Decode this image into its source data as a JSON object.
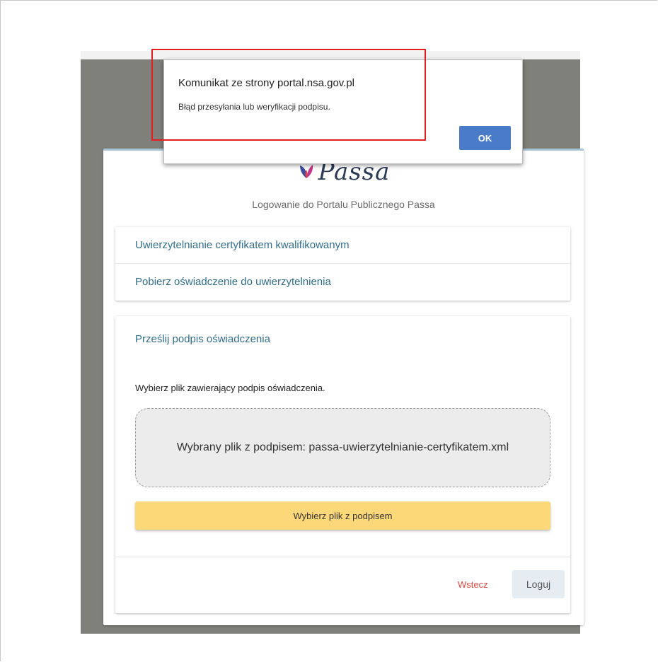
{
  "dialog": {
    "title": "Komunikat ze strony portal.nsa.gov.pl",
    "message": "Błąd przesyłania lub weryfikacji podpisu.",
    "ok_label": "OK"
  },
  "logo": {
    "text": "Passa"
  },
  "subtitle": "Logowanie do Portalu Publicznego Passa",
  "accordion": {
    "items": [
      {
        "label": "Uwierzytelnianie certyfikatem kwalifikowanym"
      },
      {
        "label": "Pobierz oświadczenie do uwierzytelnienia"
      }
    ]
  },
  "upload": {
    "title": "Prześlij podpis oświadczenia",
    "instruction": "Wybierz plik zawierający podpis oświadczenia.",
    "selected_file": "Wybrany plik z podpisem: passa-uwierzytelnianie-certyfikatem.xml",
    "choose_label": "Wybierz plik z podpisem"
  },
  "footer": {
    "back_label": "Wstecz",
    "login_label": "Loguj"
  },
  "colors": {
    "accent_link": "#2f6e8e",
    "choose_button": "#fdd878",
    "ok_button": "#4a7bc8",
    "back_link": "#e0463b",
    "highlight_box": "#e02020"
  },
  "icons": {
    "logo_icon": "feather-logo-icon"
  }
}
